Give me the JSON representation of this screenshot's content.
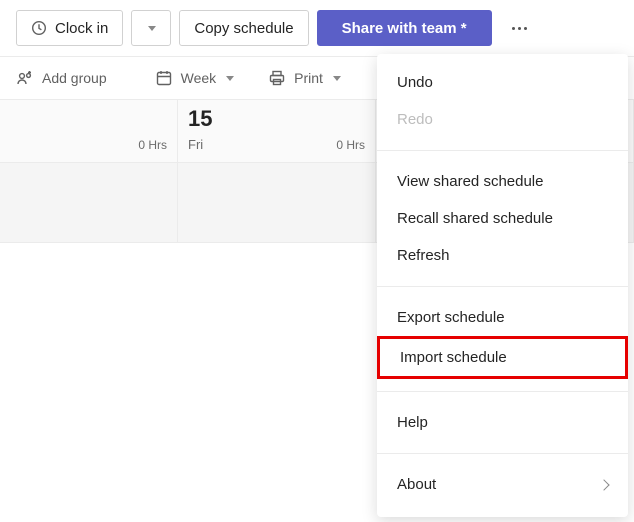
{
  "toolbar": {
    "clock_in_label": "Clock in",
    "copy_label": "Copy schedule",
    "share_label": "Share with team *"
  },
  "ribbon": {
    "add_group_label": "Add group",
    "view_label": "Week",
    "print_label": "Print"
  },
  "calendar": {
    "hours_label_left": "0 Hrs",
    "hours_label_right": "0 Hrs",
    "day_number": "15",
    "day_name": "Fri"
  },
  "menu": {
    "undo": "Undo",
    "redo": "Redo",
    "view_shared": "View shared schedule",
    "recall_shared": "Recall shared schedule",
    "refresh": "Refresh",
    "export": "Export schedule",
    "import": "Import schedule",
    "help": "Help",
    "about": "About"
  }
}
